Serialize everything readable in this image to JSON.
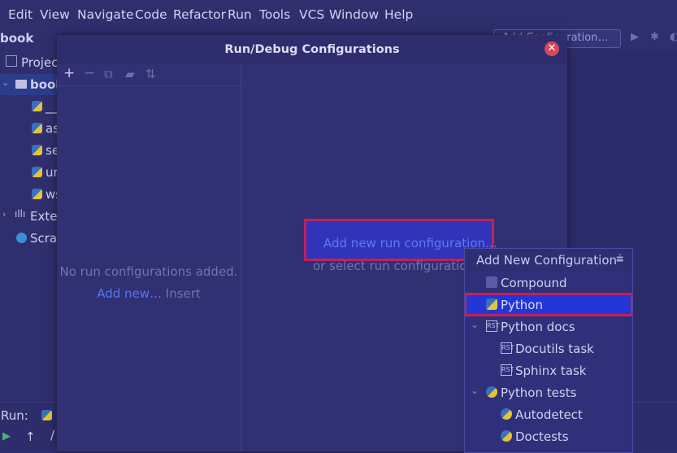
{
  "menu": [
    "Edit",
    "View",
    "Navigate",
    "Code",
    "Refactor",
    "Run",
    "Tools",
    "VCS",
    "Window",
    "Help"
  ],
  "project": {
    "title": "book",
    "tab_label": "Projec",
    "root": "book",
    "files": [
      "__",
      "as",
      "se",
      "ur",
      "ws"
    ],
    "external": "Exter",
    "scratches": "Scrat"
  },
  "toolbar": {
    "run_config": "Add Configuration…"
  },
  "bottom": {
    "run_label": "Run:",
    "path_prefix": "/"
  },
  "dialog": {
    "title": "Run/Debug Configurations",
    "no_config_text": "No run configurations added.",
    "add_new_link": "Add new…",
    "insert_hint": "Insert",
    "add_run_link": "Add new run configuration…",
    "or_select_text": "or select run configuration to"
  },
  "popup": {
    "title": "Add New Configuration",
    "items": [
      {
        "label": "Compound",
        "icon": "compound-icon"
      },
      {
        "label": "Python",
        "icon": "python-icon"
      },
      {
        "label": "Python docs",
        "icon": "rst-icon"
      },
      {
        "label": "Docutils task",
        "icon": "rst-icon"
      },
      {
        "label": "Sphinx task",
        "icon": "rst-icon"
      },
      {
        "label": "Python tests",
        "icon": "python-test-icon"
      },
      {
        "label": "Autodetect",
        "icon": "python-test-icon"
      },
      {
        "label": "Doctests",
        "icon": "python-test-icon"
      }
    ]
  },
  "colors": {
    "accent": "#2336d6",
    "highlight_border": "#c2205c",
    "link": "#5876f3",
    "close": "#d8485a"
  }
}
